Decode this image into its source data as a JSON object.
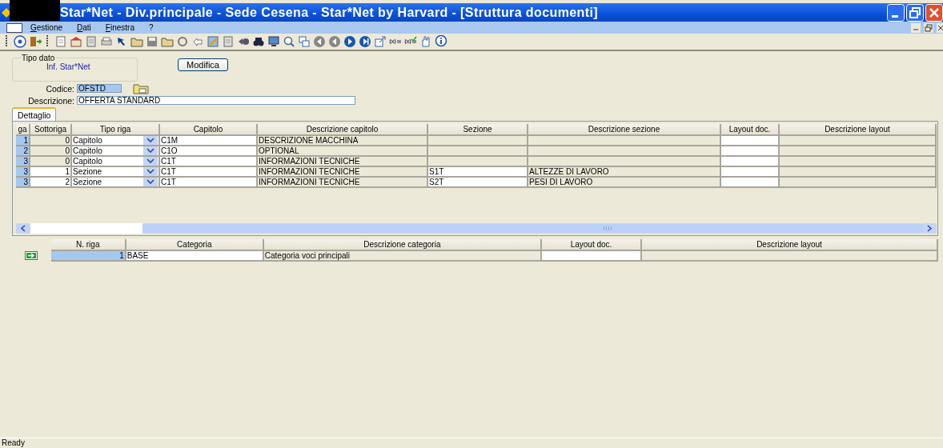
{
  "window": {
    "title": "Star*Net - Div.principale - Sede Cesena - Star*Net by Harvard - [Struttura documenti]"
  },
  "menu": [
    "Gestione",
    "Dati",
    "Finestra",
    "?"
  ],
  "form": {
    "group_label": "Tipo dato",
    "group_value": "Inf. Star*Net",
    "edit_button": "Modifica",
    "code_label": "Codice:",
    "code_value": "OFSTD",
    "description_label": "Descrizione:",
    "description_value": "OFFERTA STANDARD"
  },
  "tabs": [
    {
      "label": "Dettaglio",
      "selected": true
    }
  ],
  "main_grid": {
    "columns": [
      "ga",
      "Sottoriga",
      "Tipo riga",
      "Capitolo",
      "Descrizione capitolo",
      "Sezione",
      "Descrizione sezione",
      "Layout doc.",
      "Descrizione layout"
    ],
    "rows": [
      {
        "kind": "chapter",
        "row": "1",
        "sub_row": "0",
        "row_type": "Capitolo",
        "chapter": "C1M",
        "chapter_description": "DESCRIZIONE MACCHINA"
      },
      {
        "kind": "chapter",
        "row": "2",
        "sub_row": "0",
        "row_type": "Capitolo",
        "chapter": "C1O",
        "chapter_description": "OPTIONAL"
      },
      {
        "kind": "chapter",
        "row": "3",
        "sub_row": "0",
        "row_type": "Capitolo",
        "chapter": "C1T",
        "chapter_description": "INFORMAZIONI TECNICHE"
      },
      {
        "kind": "section",
        "row": "3",
        "sub_row": "1",
        "row_type": "Sezione",
        "chapter": "C1T",
        "chapter_description": "INFORMAZIONI TECNICHE",
        "section": "S1T",
        "section_description": "ALTEZZE DI LAVORO"
      },
      {
        "kind": "section",
        "row": "3",
        "sub_row": "2",
        "row_type": "Sezione",
        "chapter": "C1T",
        "chapter_description": "INFORMAZIONI TECNICHE",
        "section": "S2T",
        "section_description": "PESI DI LAVORO"
      }
    ]
  },
  "category_grid": {
    "columns": [
      "N. riga",
      "Categoria",
      "Descrizione categoria",
      "Layout doc.",
      "Descrizione layout"
    ],
    "rows": [
      {
        "row": "1",
        "category": "BASE",
        "category_description": "Categoria voci principali"
      }
    ]
  },
  "status_bar": "Ready"
}
